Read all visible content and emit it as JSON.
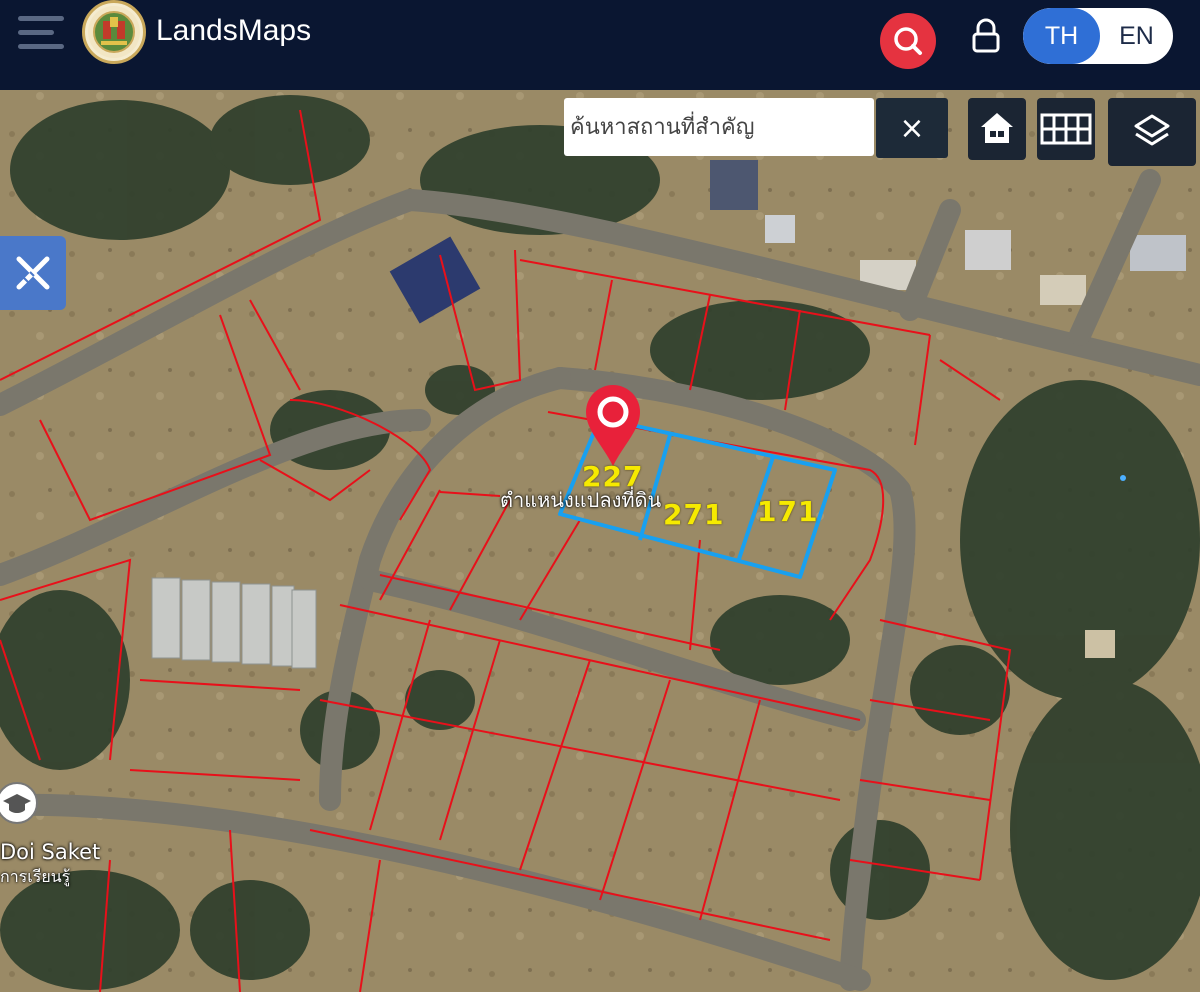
{
  "header": {
    "app_title": "LandsMaps",
    "lang_toggle": {
      "th_label": "TH",
      "en_label": "EN",
      "active": "TH"
    }
  },
  "map_controls": {
    "search_placeholder": "ค้นหาสถานที่สำคัญ",
    "clear_label": "×"
  },
  "map": {
    "parcels": [
      {
        "label": "227",
        "highlighted": true
      },
      {
        "label": "271",
        "highlighted": true
      },
      {
        "label": "171",
        "highlighted": true
      }
    ],
    "parcel_caption": "ตำแหน่งแปลงที่ดิน",
    "poi": {
      "label": "Doi Saket",
      "sublabel": "การเรียนรู้"
    },
    "colors": {
      "boundary": "#e8101a",
      "selected": "#18a0f0",
      "label": "#f6ea00",
      "pin": "#e8213a"
    }
  },
  "icons": {
    "menu": "hamburger-icon",
    "search": "search-icon",
    "lock": "lock-icon",
    "home": "home-icon",
    "grid": "grid-icon",
    "layers": "layers-icon",
    "draw": "ruler-pencil-icon",
    "pin": "map-pin-icon",
    "poi": "school-icon"
  }
}
